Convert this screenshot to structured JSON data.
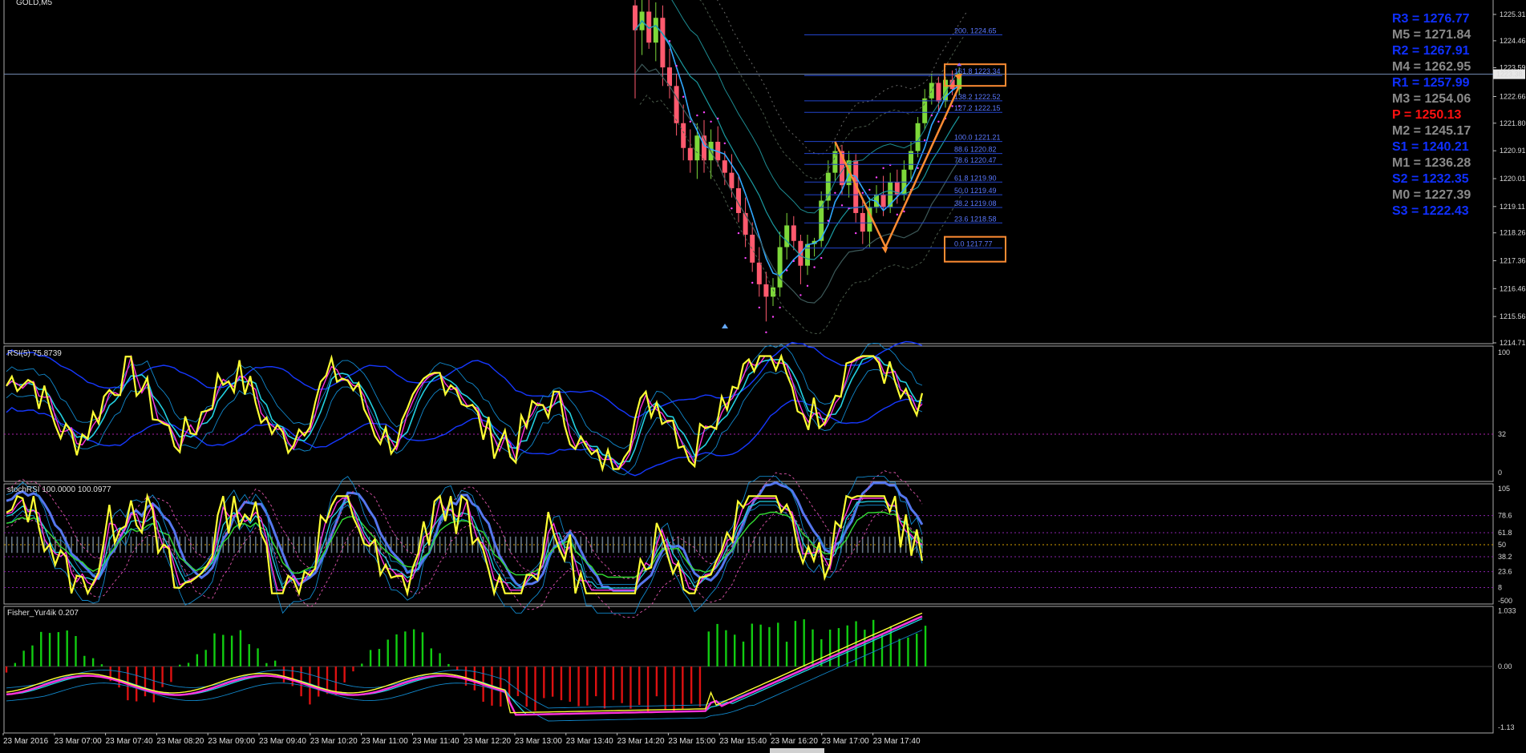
{
  "symbol_label": "GOLD,M5",
  "colors": {
    "bull": "#7dd83a",
    "bear": "#ff5a6e",
    "rsi": "#ffff33",
    "cyan": "#22d0e0",
    "magenta": "#ff33dd",
    "blueband": "#1638ff",
    "stochblue": "#5577ee",
    "fisher_up": "#11cc11",
    "fisher_down": "#dd1111",
    "pivot_r": "#1030ff",
    "pivot_m": "#8a8a8a",
    "pivot_p": "#ff1111",
    "orange": "#ff8c33",
    "fibline": "#2244cc"
  },
  "main": {
    "price_ticks": [
      "1225.31",
      "1224.46",
      "1223.59",
      "1222.66",
      "1221.80",
      "1220.91",
      "1220.01",
      "1219.11",
      "1218.26",
      "1217.36",
      "1216.46",
      "1215.56",
      "1214.71"
    ],
    "current_price": "1223.38",
    "fib_levels": [
      "200. 1224.65",
      "161.8 1223.34",
      "138.2 1222.52",
      "127.2 1222.15",
      "100.0 1221.21",
      "88.6 1220.82",
      "78.6 1220.47",
      "61.8 1219.90",
      "50.0 1219.49",
      "38.2 1219.08",
      "23.6 1218.58",
      "0.0 1217.77"
    ]
  },
  "pivots": [
    {
      "label": "R3 = 1276.77",
      "type": "r"
    },
    {
      "label": "M5 = 1271.84",
      "type": "m"
    },
    {
      "label": "R2 = 1267.91",
      "type": "r"
    },
    {
      "label": "M4 = 1262.95",
      "type": "m"
    },
    {
      "label": "R1 = 1257.99",
      "type": "r"
    },
    {
      "label": "M3 = 1254.06",
      "type": "m"
    },
    {
      "label": "P   = 1250.13",
      "type": "p"
    },
    {
      "label": "M2 = 1245.17",
      "type": "m"
    },
    {
      "label": "S1 = 1240.21",
      "type": "r"
    },
    {
      "label": "M1 = 1236.28",
      "type": "m"
    },
    {
      "label": "S2 = 1232.35",
      "type": "r"
    },
    {
      "label": "M0 = 1227.39",
      "type": "m"
    },
    {
      "label": "S3 = 1222.43",
      "type": "r"
    }
  ],
  "rsi": {
    "label": "RSI(5) 75.8739",
    "ticks": [
      "100",
      "32",
      "0"
    ]
  },
  "stoch": {
    "label": "stochRSI 100.0000 100.0977",
    "ticks": [
      "105",
      "78.6",
      "61.8",
      "50",
      "38.2",
      "23.6",
      "8",
      "-500"
    ]
  },
  "fisher": {
    "label": "Fisher_Yur4ik 0.207",
    "ticks": [
      "1.033",
      "0.00",
      "-1.13"
    ]
  },
  "time_labels": [
    "23 Mar 2016",
    "23 Mar 07:00",
    "23 Mar 07:40",
    "23 Mar 08:20",
    "23 Mar 09:00",
    "23 Mar 09:40",
    "23 Mar 10:20",
    "23 Mar 11:00",
    "23 Mar 11:40",
    "23 Mar 12:20",
    "23 Mar 13:00",
    "23 Mar 13:40",
    "23 Mar 14:20",
    "23 Mar 15:00",
    "23 Mar 15:40",
    "23 Mar 16:20",
    "23 Mar 17:00",
    "23 Mar 17:40"
  ],
  "candles": [
    {
      "o": 1225.6,
      "h": 1226.0,
      "l": 1222.6,
      "c": 1224.8
    },
    {
      "o": 1224.8,
      "h": 1225.9,
      "l": 1224.0,
      "c": 1225.4
    },
    {
      "o": 1225.4,
      "h": 1225.8,
      "l": 1224.2,
      "c": 1224.4
    },
    {
      "o": 1224.4,
      "h": 1225.7,
      "l": 1223.8,
      "c": 1225.2
    },
    {
      "o": 1225.2,
      "h": 1225.6,
      "l": 1223.0,
      "c": 1223.6
    },
    {
      "o": 1223.6,
      "h": 1224.2,
      "l": 1222.6,
      "c": 1223.0
    },
    {
      "o": 1223.0,
      "h": 1223.4,
      "l": 1221.4,
      "c": 1221.8
    },
    {
      "o": 1221.8,
      "h": 1222.4,
      "l": 1220.6,
      "c": 1221.0
    },
    {
      "o": 1221.0,
      "h": 1221.6,
      "l": 1220.2,
      "c": 1220.6
    },
    {
      "o": 1220.6,
      "h": 1221.8,
      "l": 1220.0,
      "c": 1221.4
    },
    {
      "o": 1221.4,
      "h": 1221.9,
      "l": 1220.2,
      "c": 1220.6
    },
    {
      "o": 1220.6,
      "h": 1221.6,
      "l": 1220.0,
      "c": 1221.2
    },
    {
      "o": 1221.2,
      "h": 1221.7,
      "l": 1220.4,
      "c": 1220.6
    },
    {
      "o": 1220.6,
      "h": 1220.9,
      "l": 1219.8,
      "c": 1220.2
    },
    {
      "o": 1220.2,
      "h": 1220.8,
      "l": 1219.4,
      "c": 1219.7
    },
    {
      "o": 1219.7,
      "h": 1220.1,
      "l": 1218.6,
      "c": 1218.9
    },
    {
      "o": 1218.9,
      "h": 1219.4,
      "l": 1217.8,
      "c": 1218.2
    },
    {
      "o": 1218.2,
      "h": 1218.6,
      "l": 1217.0,
      "c": 1217.3
    },
    {
      "o": 1217.3,
      "h": 1217.8,
      "l": 1216.2,
      "c": 1216.6
    },
    {
      "o": 1216.6,
      "h": 1217.0,
      "l": 1215.4,
      "c": 1216.2
    },
    {
      "o": 1216.2,
      "h": 1216.8,
      "l": 1215.9,
      "c": 1216.5
    },
    {
      "o": 1216.5,
      "h": 1218.3,
      "l": 1216.2,
      "c": 1217.8
    },
    {
      "o": 1217.8,
      "h": 1218.9,
      "l": 1217.4,
      "c": 1218.5
    },
    {
      "o": 1218.5,
      "h": 1218.8,
      "l": 1217.7,
      "c": 1218.0
    },
    {
      "o": 1218.0,
      "h": 1218.2,
      "l": 1216.6,
      "c": 1217.2
    },
    {
      "o": 1217.2,
      "h": 1218.2,
      "l": 1216.9,
      "c": 1217.9
    },
    {
      "o": 1217.9,
      "h": 1218.1,
      "l": 1217.5,
      "c": 1218.0
    },
    {
      "o": 1218.0,
      "h": 1219.6,
      "l": 1217.8,
      "c": 1219.3
    },
    {
      "o": 1219.3,
      "h": 1220.6,
      "l": 1219.0,
      "c": 1220.2
    },
    {
      "o": 1220.2,
      "h": 1221.2,
      "l": 1219.9,
      "c": 1220.9
    },
    {
      "o": 1220.9,
      "h": 1221.1,
      "l": 1219.5,
      "c": 1219.8
    },
    {
      "o": 1219.8,
      "h": 1220.9,
      "l": 1219.4,
      "c": 1220.6
    },
    {
      "o": 1220.6,
      "h": 1220.8,
      "l": 1218.6,
      "c": 1218.9
    },
    {
      "o": 1218.9,
      "h": 1219.3,
      "l": 1217.9,
      "c": 1218.3
    },
    {
      "o": 1218.3,
      "h": 1219.4,
      "l": 1217.8,
      "c": 1219.1
    },
    {
      "o": 1219.1,
      "h": 1219.8,
      "l": 1218.9,
      "c": 1219.5
    },
    {
      "o": 1219.5,
      "h": 1220.1,
      "l": 1218.8,
      "c": 1219.1
    },
    {
      "o": 1219.1,
      "h": 1220.2,
      "l": 1218.9,
      "c": 1219.9
    },
    {
      "o": 1219.9,
      "h": 1220.3,
      "l": 1219.2,
      "c": 1219.5
    },
    {
      "o": 1219.5,
      "h": 1220.6,
      "l": 1219.3,
      "c": 1220.3
    },
    {
      "o": 1220.3,
      "h": 1221.2,
      "l": 1220.0,
      "c": 1220.9
    },
    {
      "o": 1220.9,
      "h": 1222.0,
      "l": 1220.7,
      "c": 1221.8
    },
    {
      "o": 1221.8,
      "h": 1222.9,
      "l": 1221.6,
      "c": 1222.6
    },
    {
      "o": 1222.6,
      "h": 1223.4,
      "l": 1222.4,
      "c": 1223.1
    },
    {
      "o": 1223.1,
      "h": 1223.3,
      "l": 1222.2,
      "c": 1222.5
    },
    {
      "o": 1222.5,
      "h": 1223.3,
      "l": 1222.3,
      "c": 1223.2
    },
    {
      "o": 1223.2,
      "h": 1223.5,
      "l": 1222.7,
      "c": 1222.9
    },
    {
      "o": 1222.9,
      "h": 1223.6,
      "l": 1222.7,
      "c": 1223.4
    }
  ]
}
